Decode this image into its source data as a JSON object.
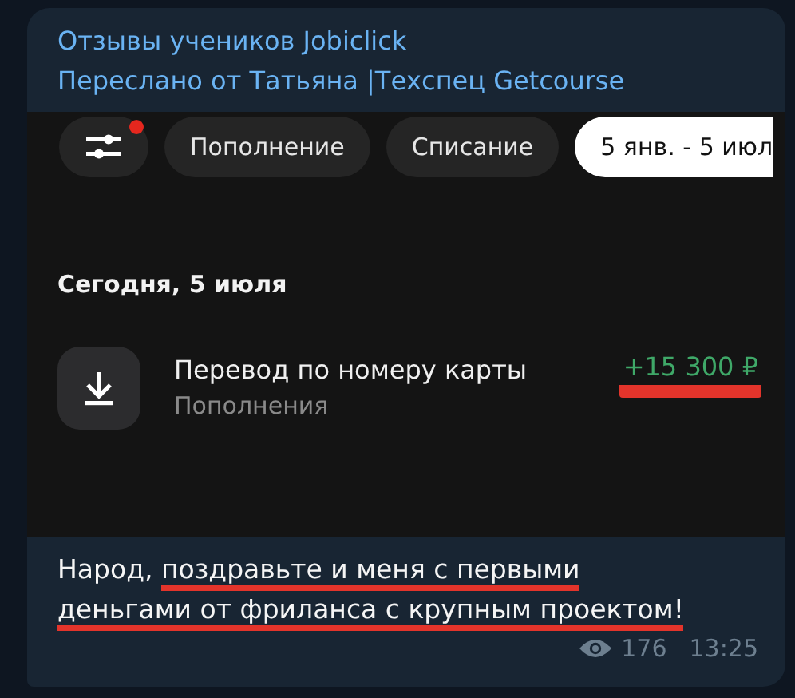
{
  "channel_title": "Отзывы учеников Jobiclick",
  "forwarded_from": "Переслано от Татьяна |Техспец Getcourse",
  "screenshot": {
    "filter_button": {
      "badge": true
    },
    "chips": [
      {
        "label": "Пополнение",
        "selected": false
      },
      {
        "label": "Списание",
        "selected": false
      },
      {
        "label": "5 янв. - 5 июл",
        "selected": true
      }
    ],
    "date_heading": "Сегодня, 5 июля",
    "transactions": [
      {
        "title": "Перевод по номеру карты",
        "category": "Пополнения",
        "amount": "+15 300 ₽",
        "kind": "income",
        "underlined": true
      }
    ]
  },
  "message": [
    {
      "text": "Народ, ",
      "underlined": false
    },
    {
      "text": "поздравьте и меня с первыми деньгами от фриланса с крупным проектом!",
      "underlined": true
    }
  ],
  "views": "176",
  "time": "13:25"
}
